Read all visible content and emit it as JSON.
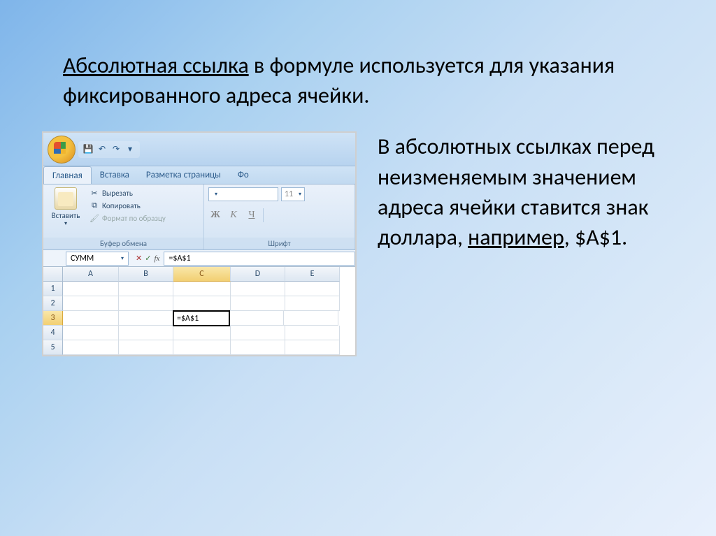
{
  "top": {
    "underlined": "Абсолютная ссылка",
    "rest": " в формуле используется для указания фиксированного адреса ячейки."
  },
  "side": {
    "part1": "В абсолютных ссылках перед неизменяемым значением адреса ячейки ставится знак доллара, ",
    "underlined": "например",
    "part2": ", $A$1."
  },
  "excel": {
    "tabs": {
      "home": "Главная",
      "insert": "Вставка",
      "layout": "Разметка страницы",
      "formulas": "Фо"
    },
    "clipboard": {
      "paste": "Вставить",
      "cut": "Вырезать",
      "copy": "Копировать",
      "format_painter": "Формат по образцу",
      "group": "Буфер обмена"
    },
    "font": {
      "size": "11",
      "bold": "Ж",
      "italic": "К",
      "underline": "Ч",
      "group": "Шрифт"
    },
    "namebox": "СУММ",
    "formula": "=$A$1",
    "columns": [
      "A",
      "B",
      "C",
      "D",
      "E"
    ],
    "rows": [
      "1",
      "2",
      "3",
      "4",
      "5"
    ],
    "active_cell_value": "=$A$1"
  }
}
